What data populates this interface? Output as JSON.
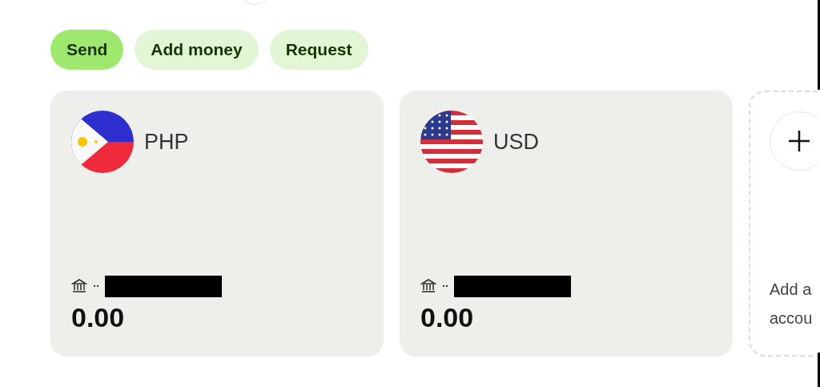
{
  "actions": [
    {
      "label": "Send",
      "selected": true
    },
    {
      "label": "Add money",
      "selected": false
    },
    {
      "label": "Request",
      "selected": false
    }
  ],
  "accounts": [
    {
      "kind": "currency",
      "code": "PHP",
      "flag": {
        "kind": "ph"
      },
      "account_hidden": true,
      "balance": "0.00"
    },
    {
      "kind": "currency",
      "code": "USD",
      "flag": {
        "kind": "us"
      },
      "account_hidden": true,
      "balance": "0.00"
    },
    {
      "kind": "add",
      "lines": [
        "Add a",
        "accou"
      ]
    }
  ]
}
